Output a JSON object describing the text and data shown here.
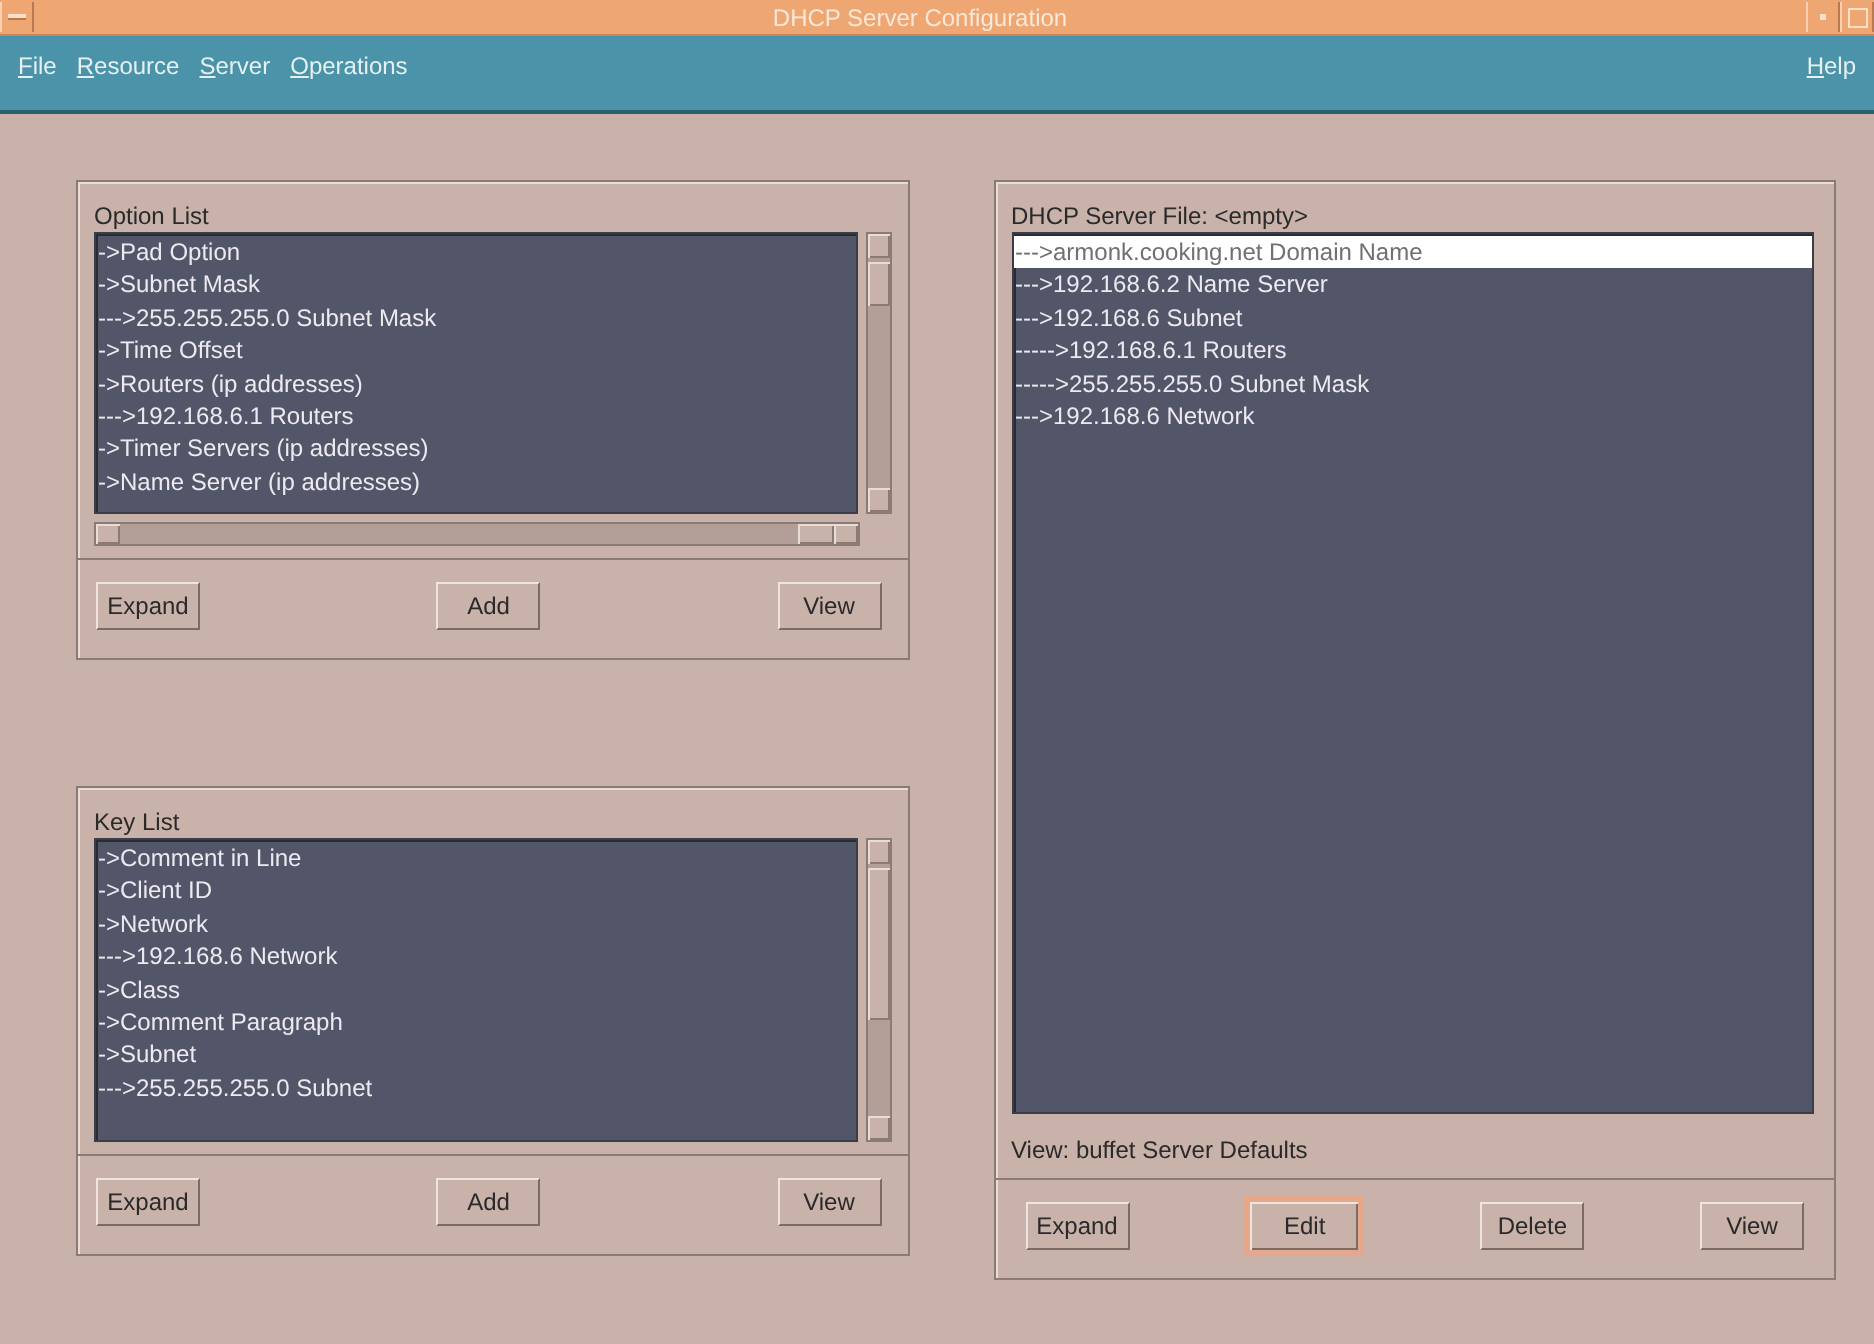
{
  "window": {
    "title": "DHCP Server Configuration"
  },
  "menu": [
    {
      "label": "File",
      "first_letter_underlined": true
    },
    {
      "label": "Resource",
      "first_letter_underlined": true
    },
    {
      "label": "Server",
      "first_letter_underlined": true
    },
    {
      "label": "Operations",
      "first_letter_underlined": true
    }
  ],
  "help_menu": {
    "label": "Help",
    "first_letter_underlined": true
  },
  "option_list": {
    "title": "Option List",
    "items": [
      {
        "text": "->Pad Option",
        "selected": false
      },
      {
        "text": "->Subnet Mask",
        "selected": false
      },
      {
        "text": "--->255.255.255.0 Subnet Mask",
        "selected": false
      },
      {
        "text": "->Time Offset",
        "selected": false
      },
      {
        "text": "->Routers (ip addresses)",
        "selected": false
      },
      {
        "text": "--->192.168.6.1 Routers",
        "selected": false
      },
      {
        "text": "->Timer Servers (ip addresses)",
        "selected": false
      },
      {
        "text": "->Name Server (ip addresses)",
        "selected": false
      }
    ],
    "buttons": [
      {
        "label": "Expand",
        "focused": false
      },
      {
        "label": "Add",
        "focused": false
      },
      {
        "label": "View",
        "focused": false
      }
    ]
  },
  "key_list": {
    "title": "Key List",
    "items": [
      {
        "text": "->Comment in Line",
        "selected": false
      },
      {
        "text": "->Client ID",
        "selected": false
      },
      {
        "text": "->Network",
        "selected": false
      },
      {
        "text": "--->192.168.6 Network",
        "selected": false
      },
      {
        "text": "->Class",
        "selected": false
      },
      {
        "text": "->Comment Paragraph",
        "selected": false
      },
      {
        "text": "->Subnet",
        "selected": false
      },
      {
        "text": "--->255.255.255.0 Subnet",
        "selected": false
      }
    ],
    "buttons": [
      {
        "label": "Expand",
        "focused": false
      },
      {
        "label": "Add",
        "focused": false
      },
      {
        "label": "View",
        "focused": false
      }
    ]
  },
  "server_file": {
    "title": "DHCP Server File: <empty>",
    "items": [
      {
        "text": "--->armonk.cooking.net Domain Name",
        "selected": true
      },
      {
        "text": "--->192.168.6.2 Name Server",
        "selected": false
      },
      {
        "text": "--->192.168.6 Subnet",
        "selected": false
      },
      {
        "text": "----->192.168.6.1 Routers",
        "selected": false
      },
      {
        "text": "----->255.255.255.0 Subnet Mask",
        "selected": false
      },
      {
        "text": "--->192.168.6 Network",
        "selected": false
      }
    ],
    "status": "View: buffet Server Defaults",
    "buttons": [
      {
        "label": "Expand",
        "focused": false
      },
      {
        "label": "Edit",
        "focused": true
      },
      {
        "label": "Delete",
        "focused": false
      },
      {
        "label": "View",
        "focused": false
      }
    ]
  }
}
